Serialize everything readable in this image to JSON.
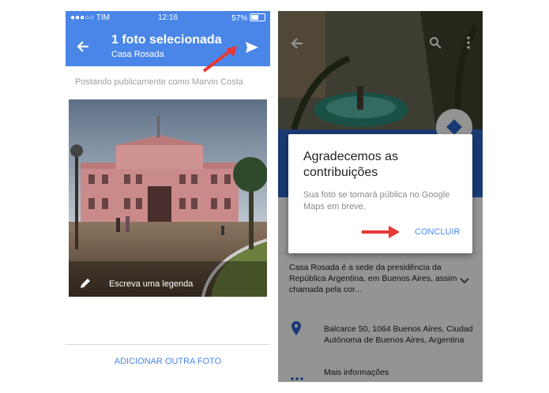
{
  "left": {
    "status": {
      "carrier": "●●●○○ TIM",
      "time": "12:16",
      "battery": "57%"
    },
    "header": {
      "title": "1 foto selecionada",
      "subtitle": "Casa Rosada"
    },
    "posting_as": "Postando publicamente como Marvin Costa",
    "caption_placeholder": "Escreva uma legenda",
    "add_photo": "ADICIONAR OUTRA FOTO"
  },
  "right": {
    "dialog": {
      "title": "Agradecemos as contribuições",
      "body": "Sua foto se tornará pública no Google Maps em breve.",
      "button": "CONCLUIR"
    },
    "place_description": "Casa Rosada é a sede da presidência da República Argentina, em Buenos Aires, assim chamada pela cor...",
    "address": "Balcarce 50, 1064 Buenos Aires, Ciudad Autónoma de Buenos Aires, Argentina",
    "more_info": "Mais informações"
  },
  "colors": {
    "accent": "#4a86e8",
    "annotation_arrow": "#e53935"
  }
}
